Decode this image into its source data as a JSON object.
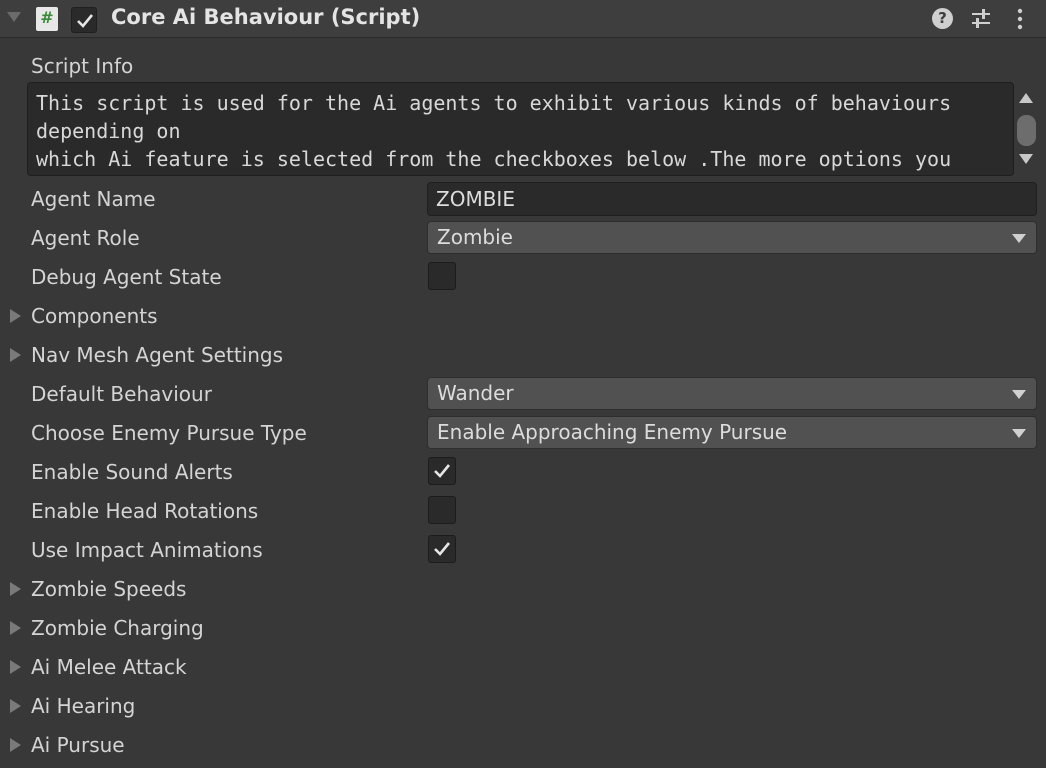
{
  "header": {
    "title": "Core Ai Behaviour (Script)",
    "script_icon": "#",
    "enabled": true,
    "help_icon": "?",
    "icons": [
      "foldout-expanded-icon",
      "script-icon",
      "help-icon",
      "presets-icon",
      "kebab-menu-icon"
    ]
  },
  "script_info": {
    "label": "Script Info",
    "text": "This script is used for the Ai agents to exhibit various kinds of behaviours depending on\nwhich Ai feature is selected from the checkboxes below .The more options you will select\nfrom the checkboxes below the heavier the Ai will become in terms of performance as the"
  },
  "fields": {
    "agent_name": {
      "label": "Agent Name",
      "value": "ZOMBIE"
    },
    "agent_role": {
      "label": "Agent Role",
      "value": "Zombie"
    },
    "debug_agent_state": {
      "label": "Debug Agent State",
      "checked": false
    },
    "components": {
      "label": "Components"
    },
    "nav_mesh_agent_settings": {
      "label": "Nav Mesh Agent Settings"
    },
    "default_behaviour": {
      "label": "Default Behaviour",
      "value": "Wander"
    },
    "enemy_pursue_type": {
      "label": "Choose Enemy Pursue Type",
      "value": "Enable Approaching Enemy Pursue"
    },
    "enable_sound_alerts": {
      "label": "Enable Sound Alerts",
      "checked": true
    },
    "enable_head_rotations": {
      "label": "Enable Head Rotations",
      "checked": false
    },
    "use_impact_animations": {
      "label": "Use Impact Animations",
      "checked": true
    },
    "zombie_speeds": {
      "label": "Zombie Speeds"
    },
    "zombie_charging": {
      "label": "Zombie Charging"
    },
    "ai_melee_attack": {
      "label": "Ai Melee Attack"
    },
    "ai_hearing": {
      "label": "Ai Hearing"
    },
    "ai_pursue": {
      "label": "Ai Pursue"
    }
  },
  "colors": {
    "background": "#383838",
    "header": "#3e3e3e",
    "field_bg": "#2a2a2a",
    "dropdown_bg": "#515151",
    "text": "#d4d4d4"
  }
}
